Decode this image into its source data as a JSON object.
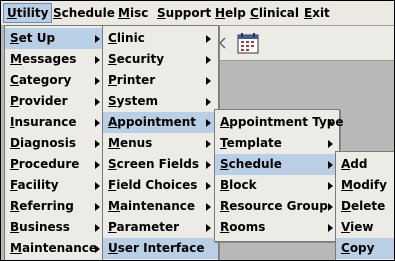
{
  "menubar": [
    {
      "label": "Utility",
      "mnemonic": "U",
      "active": true
    },
    {
      "label": "Schedule",
      "mnemonic": "S"
    },
    {
      "label": "Misc",
      "mnemonic": "M"
    },
    {
      "label": "Support",
      "mnemonic": "S"
    },
    {
      "label": "Help",
      "mnemonic": "H"
    },
    {
      "label": "Clinical",
      "mnemonic": "C"
    },
    {
      "label": "Exit",
      "mnemonic": "E"
    }
  ],
  "toolbar": {
    "icons": [
      "close-icon",
      "calendar-icon"
    ]
  },
  "utility_menu": [
    {
      "label": "Set Up",
      "mnemonic": "S",
      "submenu": true,
      "highlighted": true
    },
    {
      "label": "Messages",
      "mnemonic": "M",
      "submenu": true
    },
    {
      "label": "Category",
      "mnemonic": "C",
      "submenu": true
    },
    {
      "label": "Provider",
      "mnemonic": "P",
      "submenu": true
    },
    {
      "label": "Insurance",
      "mnemonic": "I",
      "submenu": true
    },
    {
      "label": "Diagnosis",
      "mnemonic": "D",
      "submenu": true
    },
    {
      "label": "Procedure",
      "mnemonic": "P",
      "submenu": true
    },
    {
      "label": "Facility",
      "mnemonic": "F",
      "submenu": true
    },
    {
      "label": "Referring",
      "mnemonic": "R",
      "submenu": true
    },
    {
      "label": "Business",
      "mnemonic": "B",
      "submenu": true
    },
    {
      "label": "Maintenance",
      "mnemonic": "M",
      "submenu": true
    }
  ],
  "setup_menu": [
    {
      "label": "Clinic",
      "mnemonic": "C",
      "submenu": true
    },
    {
      "label": "Security",
      "mnemonic": "S",
      "submenu": true
    },
    {
      "label": "Printer",
      "mnemonic": "P",
      "submenu": true
    },
    {
      "label": "System",
      "mnemonic": "S",
      "submenu": true
    },
    {
      "label": "Appointment",
      "mnemonic": "A",
      "submenu": true,
      "highlighted": true
    },
    {
      "label": "Menus",
      "mnemonic": "M",
      "submenu": true
    },
    {
      "label": "Screen Fields",
      "mnemonic": "S",
      "submenu": true
    },
    {
      "label": "Field Choices",
      "mnemonic": "F",
      "submenu": true
    },
    {
      "label": "Maintenance",
      "mnemonic": "M",
      "submenu": true
    },
    {
      "label": "Parameter",
      "mnemonic": "P",
      "submenu": true
    },
    {
      "label": "User Interface",
      "mnemonic": "U",
      "submenu": false,
      "highlighted": true
    }
  ],
  "appointment_menu": [
    {
      "label": "Appointment Type",
      "mnemonic": "A",
      "submenu": true
    },
    {
      "label": "Template",
      "mnemonic": "T",
      "submenu": true
    },
    {
      "label": "Schedule",
      "mnemonic": "S",
      "submenu": true,
      "highlighted": true
    },
    {
      "label": "Block",
      "mnemonic": "B",
      "submenu": true
    },
    {
      "label": "Resource Group",
      "mnemonic": "R",
      "submenu": true
    },
    {
      "label": "Rooms",
      "mnemonic": "R",
      "submenu": true
    }
  ],
  "schedule_menu": [
    {
      "label": "Add",
      "mnemonic": "A"
    },
    {
      "label": "Modify",
      "mnemonic": "M"
    },
    {
      "label": "Delete",
      "mnemonic": "D"
    },
    {
      "label": "View",
      "mnemonic": "V"
    },
    {
      "label": "Copy",
      "mnemonic": "C",
      "highlighted": true
    }
  ]
}
